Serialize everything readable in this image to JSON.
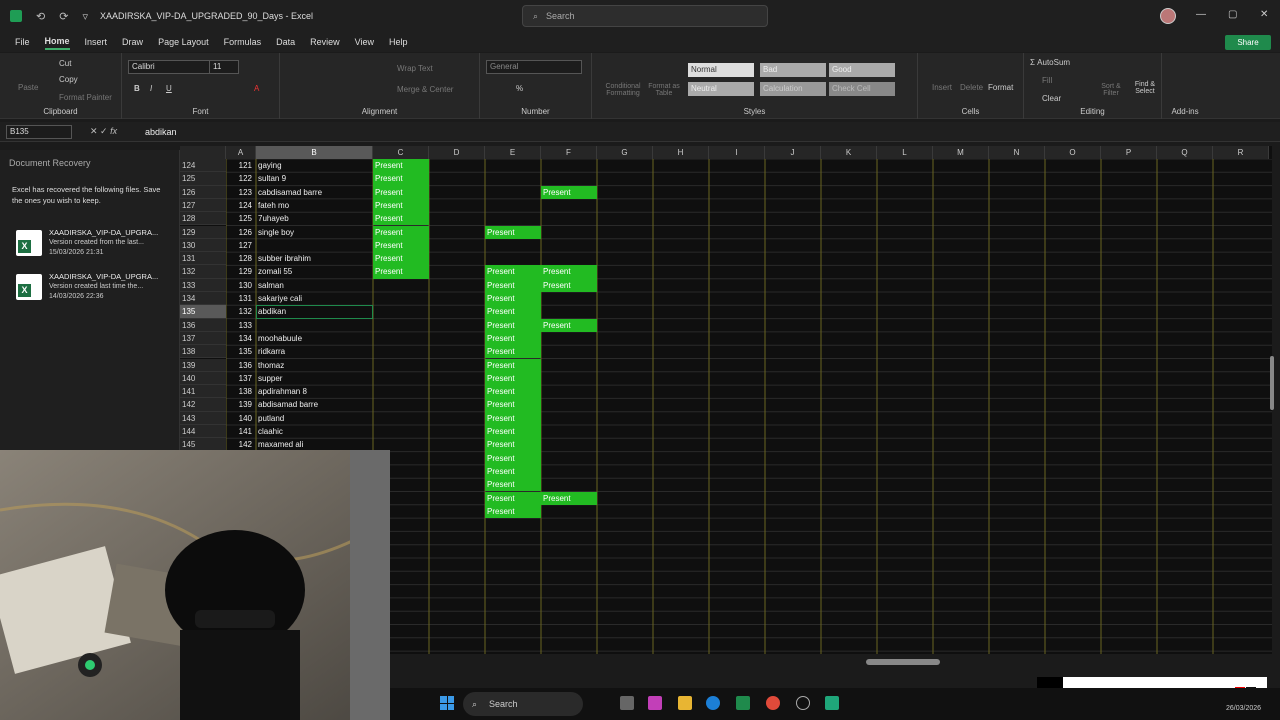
{
  "window": {
    "title": "XAADIRSKA_VIP-DA_UPGRADED_90_Days - Excel",
    "search_placeholder": "Search"
  },
  "menu": [
    "File",
    "Home",
    "Insert",
    "Draw",
    "Page Layout",
    "Formulas",
    "Data",
    "Review",
    "View",
    "Help"
  ],
  "active_menu": "Home",
  "share_label": "Share",
  "ribbon": {
    "clipboard": {
      "label": "Clipboard",
      "paste": "Paste",
      "cut": "Cut",
      "copy": "Copy",
      "format_painter": "Format Painter"
    },
    "font": {
      "label": "Font",
      "font_name": "Calibri",
      "font_size": "11"
    },
    "alignment": {
      "label": "Alignment",
      "wrap_text": "Wrap Text",
      "merge_center": "Merge & Center"
    },
    "number": {
      "label": "Number",
      "format": "General"
    },
    "styles": {
      "label": "Styles",
      "conditional": "Conditional Formatting",
      "format_table": "Format as Table",
      "normal": "Normal",
      "bad": "Bad",
      "good": "Good",
      "neutral": "Neutral",
      "calculation": "Calculation",
      "check_cell": "Check Cell"
    },
    "cells": {
      "label": "Cells",
      "insert": "Insert",
      "delete": "Delete",
      "format": "Format"
    },
    "editing": {
      "label": "Editing",
      "autosum": "AutoSum",
      "fill": "Fill",
      "clear": "Clear",
      "sort_filter": "Sort & Filter",
      "find_select": "Find & Select"
    },
    "addins": {
      "label": "Add-ins"
    }
  },
  "formula_bar": {
    "name_box": "B135",
    "fx": "fx",
    "value": "abdikan"
  },
  "recovery": {
    "title": "Document Recovery",
    "description": "Excel has recovered the following files.  Save the ones you wish to keep.",
    "files": [
      {
        "name": "XAADIRSKA_VIP-DA_UPGRA...",
        "sub": "Version created from the last...",
        "date": "15/03/2026 21:31"
      },
      {
        "name": "XAADIRSKA_VIP-DA_UPGRA...",
        "sub": "Version created last time the...",
        "date": "14/03/2026 22:36"
      }
    ]
  },
  "columns": [
    "A",
    "B",
    "C",
    "D",
    "E",
    "F",
    "G",
    "H",
    "I",
    "J",
    "K",
    "L",
    "M",
    "N",
    "O",
    "P",
    "Q",
    "R"
  ],
  "rows": [
    {
      "r": "124",
      "a": "121",
      "b": "gaying",
      "c": "Present",
      "e": "",
      "f": ""
    },
    {
      "r": "125",
      "a": "122",
      "b": "sultan 9",
      "c": "Present",
      "e": "",
      "f": ""
    },
    {
      "r": "126",
      "a": "123",
      "b": "cabdisamad barre",
      "c": "Present",
      "e": "",
      "f": "Present"
    },
    {
      "r": "127",
      "a": "124",
      "b": "fateh mo",
      "c": "Present",
      "e": "",
      "f": ""
    },
    {
      "r": "128",
      "a": "125",
      "b": "7uhayeb",
      "c": "Present",
      "e": "",
      "f": ""
    },
    {
      "r": "129",
      "a": "126",
      "b": "single boy",
      "c": "Present",
      "e": "Present",
      "f": ""
    },
    {
      "r": "130",
      "a": "127",
      "b": "",
      "c": "Present",
      "e": "",
      "f": ""
    },
    {
      "r": "131",
      "a": "128",
      "b": "subber ibrahim",
      "c": "Present",
      "e": "",
      "f": ""
    },
    {
      "r": "132",
      "a": "129",
      "b": "zomali 55",
      "c": "Present",
      "e": "Present",
      "f": "Present"
    },
    {
      "r": "133",
      "a": "130",
      "b": "salman",
      "c": "",
      "e": "Present",
      "f": "Present"
    },
    {
      "r": "134",
      "a": "131",
      "b": "sakariye cali",
      "c": "",
      "e": "Present",
      "f": ""
    },
    {
      "r": "135",
      "a": "132",
      "b": "abdikan",
      "c": "",
      "e": "Present",
      "f": ""
    },
    {
      "r": "136",
      "a": "133",
      "b": "",
      "c": "",
      "e": "Present",
      "f": "Present"
    },
    {
      "r": "137",
      "a": "134",
      "b": "moohabuule",
      "c": "",
      "e": "Present",
      "f": ""
    },
    {
      "r": "138",
      "a": "135",
      "b": "ridkarra",
      "c": "",
      "e": "Present",
      "f": ""
    },
    {
      "r": "139",
      "a": "136",
      "b": "thomaz",
      "c": "",
      "e": "Present",
      "f": ""
    },
    {
      "r": "140",
      "a": "137",
      "b": "supper",
      "c": "",
      "e": "Present",
      "f": ""
    },
    {
      "r": "141",
      "a": "138",
      "b": "apdirahman 8",
      "c": "",
      "e": "Present",
      "f": ""
    },
    {
      "r": "142",
      "a": "139",
      "b": "abdisamad barre",
      "c": "",
      "e": "Present",
      "f": ""
    },
    {
      "r": "143",
      "a": "140",
      "b": "putland",
      "c": "",
      "e": "Present",
      "f": ""
    },
    {
      "r": "144",
      "a": "141",
      "b": "claahic",
      "c": "",
      "e": "Present",
      "f": ""
    },
    {
      "r": "145",
      "a": "142",
      "b": "maxamed ali",
      "c": "",
      "e": "Present",
      "f": ""
    },
    {
      "r": "",
      "a": "",
      "b": "",
      "c": "",
      "e": "Present",
      "f": ""
    },
    {
      "r": "",
      "a": "",
      "b": "",
      "c": "",
      "e": "Present",
      "f": ""
    },
    {
      "r": "",
      "a": "",
      "b": "",
      "c": "",
      "e": "Present",
      "f": ""
    },
    {
      "r": "",
      "a": "",
      "b": "",
      "c": "",
      "e": "Present",
      "f": "Present"
    },
    {
      "r": "",
      "a": "",
      "b": "",
      "c": "",
      "e": "Present",
      "f": ""
    }
  ],
  "selected_row": "135",
  "taskbar": {
    "search": "Search",
    "date": "26/03/2026"
  },
  "colors": {
    "present_green": "#22bb22",
    "accent": "#1f8a4c"
  }
}
